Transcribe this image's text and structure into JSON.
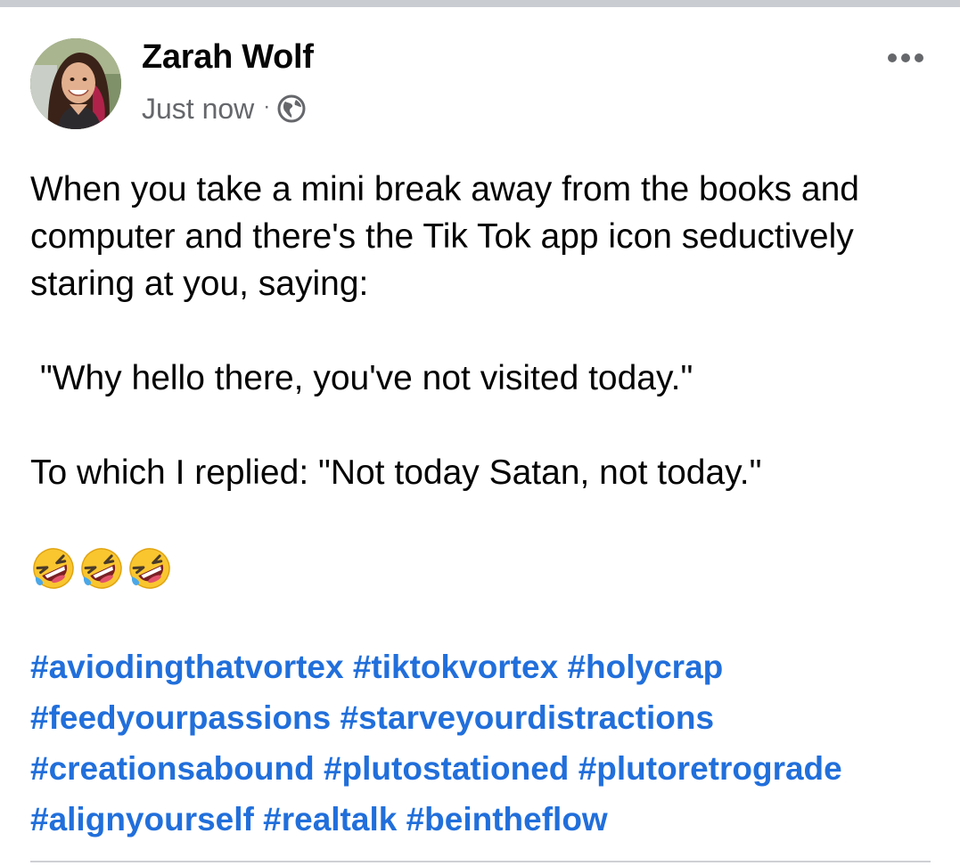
{
  "post": {
    "author_name": "Zarah Wolf",
    "timestamp": "Just now",
    "separator": "·",
    "privacy_icon": "globe-icon",
    "more_icon": "more-horizontal-icon",
    "body": {
      "line1": "When you take a mini break away from the books and",
      "line2": "computer and there's the Tik Tok app icon seductively",
      "line3": "staring at you, saying:",
      "quote": " \"Why hello there, you've not visited today.\"",
      "reply": "To which I replied: \"Not today Satan, not today.\""
    },
    "emojis": [
      "rolling-on-floor-laughing",
      "rolling-on-floor-laughing",
      "rolling-on-floor-laughing"
    ],
    "hashtags": [
      "#aviodingthatvortex",
      "#tiktokvortex",
      "#holycrap",
      "#feedyourpassions",
      "#starveyourdistractions",
      "#creationsabound",
      "#plutostationed",
      "#plutoretrograde",
      "#alignyourself",
      "#realtalk",
      "#beintheflow"
    ]
  },
  "colors": {
    "name_text": "#050505",
    "meta_text": "#65676b",
    "hashtag": "#216fdb",
    "divider": "#ced0d4",
    "top_strip": "#c9ccd1"
  }
}
